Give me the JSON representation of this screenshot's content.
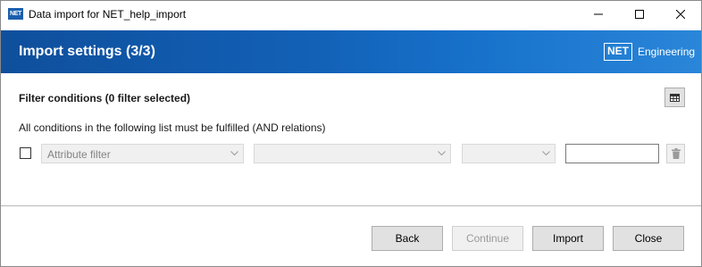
{
  "window": {
    "logo_text": "NET",
    "title": "Data import for NET_help_import"
  },
  "header": {
    "title": "Import settings (3/3)",
    "brand_box": "NET",
    "brand_text": "Engineering",
    "gradient_start": "#0f4f9c",
    "gradient_end": "#2a86d8"
  },
  "filters": {
    "heading": "Filter conditions (0 filter selected)",
    "condition_text": "All conditions in the following list must be fulfilled (AND relations)",
    "row": {
      "checked": false,
      "attribute_select": "Attribute filter",
      "operator_select": "",
      "value_select": "",
      "value_input": ""
    }
  },
  "footer": {
    "back_label": "Back",
    "continue_label": "Continue",
    "import_label": "Import",
    "close_label": "Close"
  },
  "icons": {
    "minimize": "minimize-icon",
    "maximize": "maximize-icon",
    "close": "close-icon",
    "table": "table-icon",
    "trash": "trash-icon",
    "chevron": "chevron-down-icon"
  }
}
